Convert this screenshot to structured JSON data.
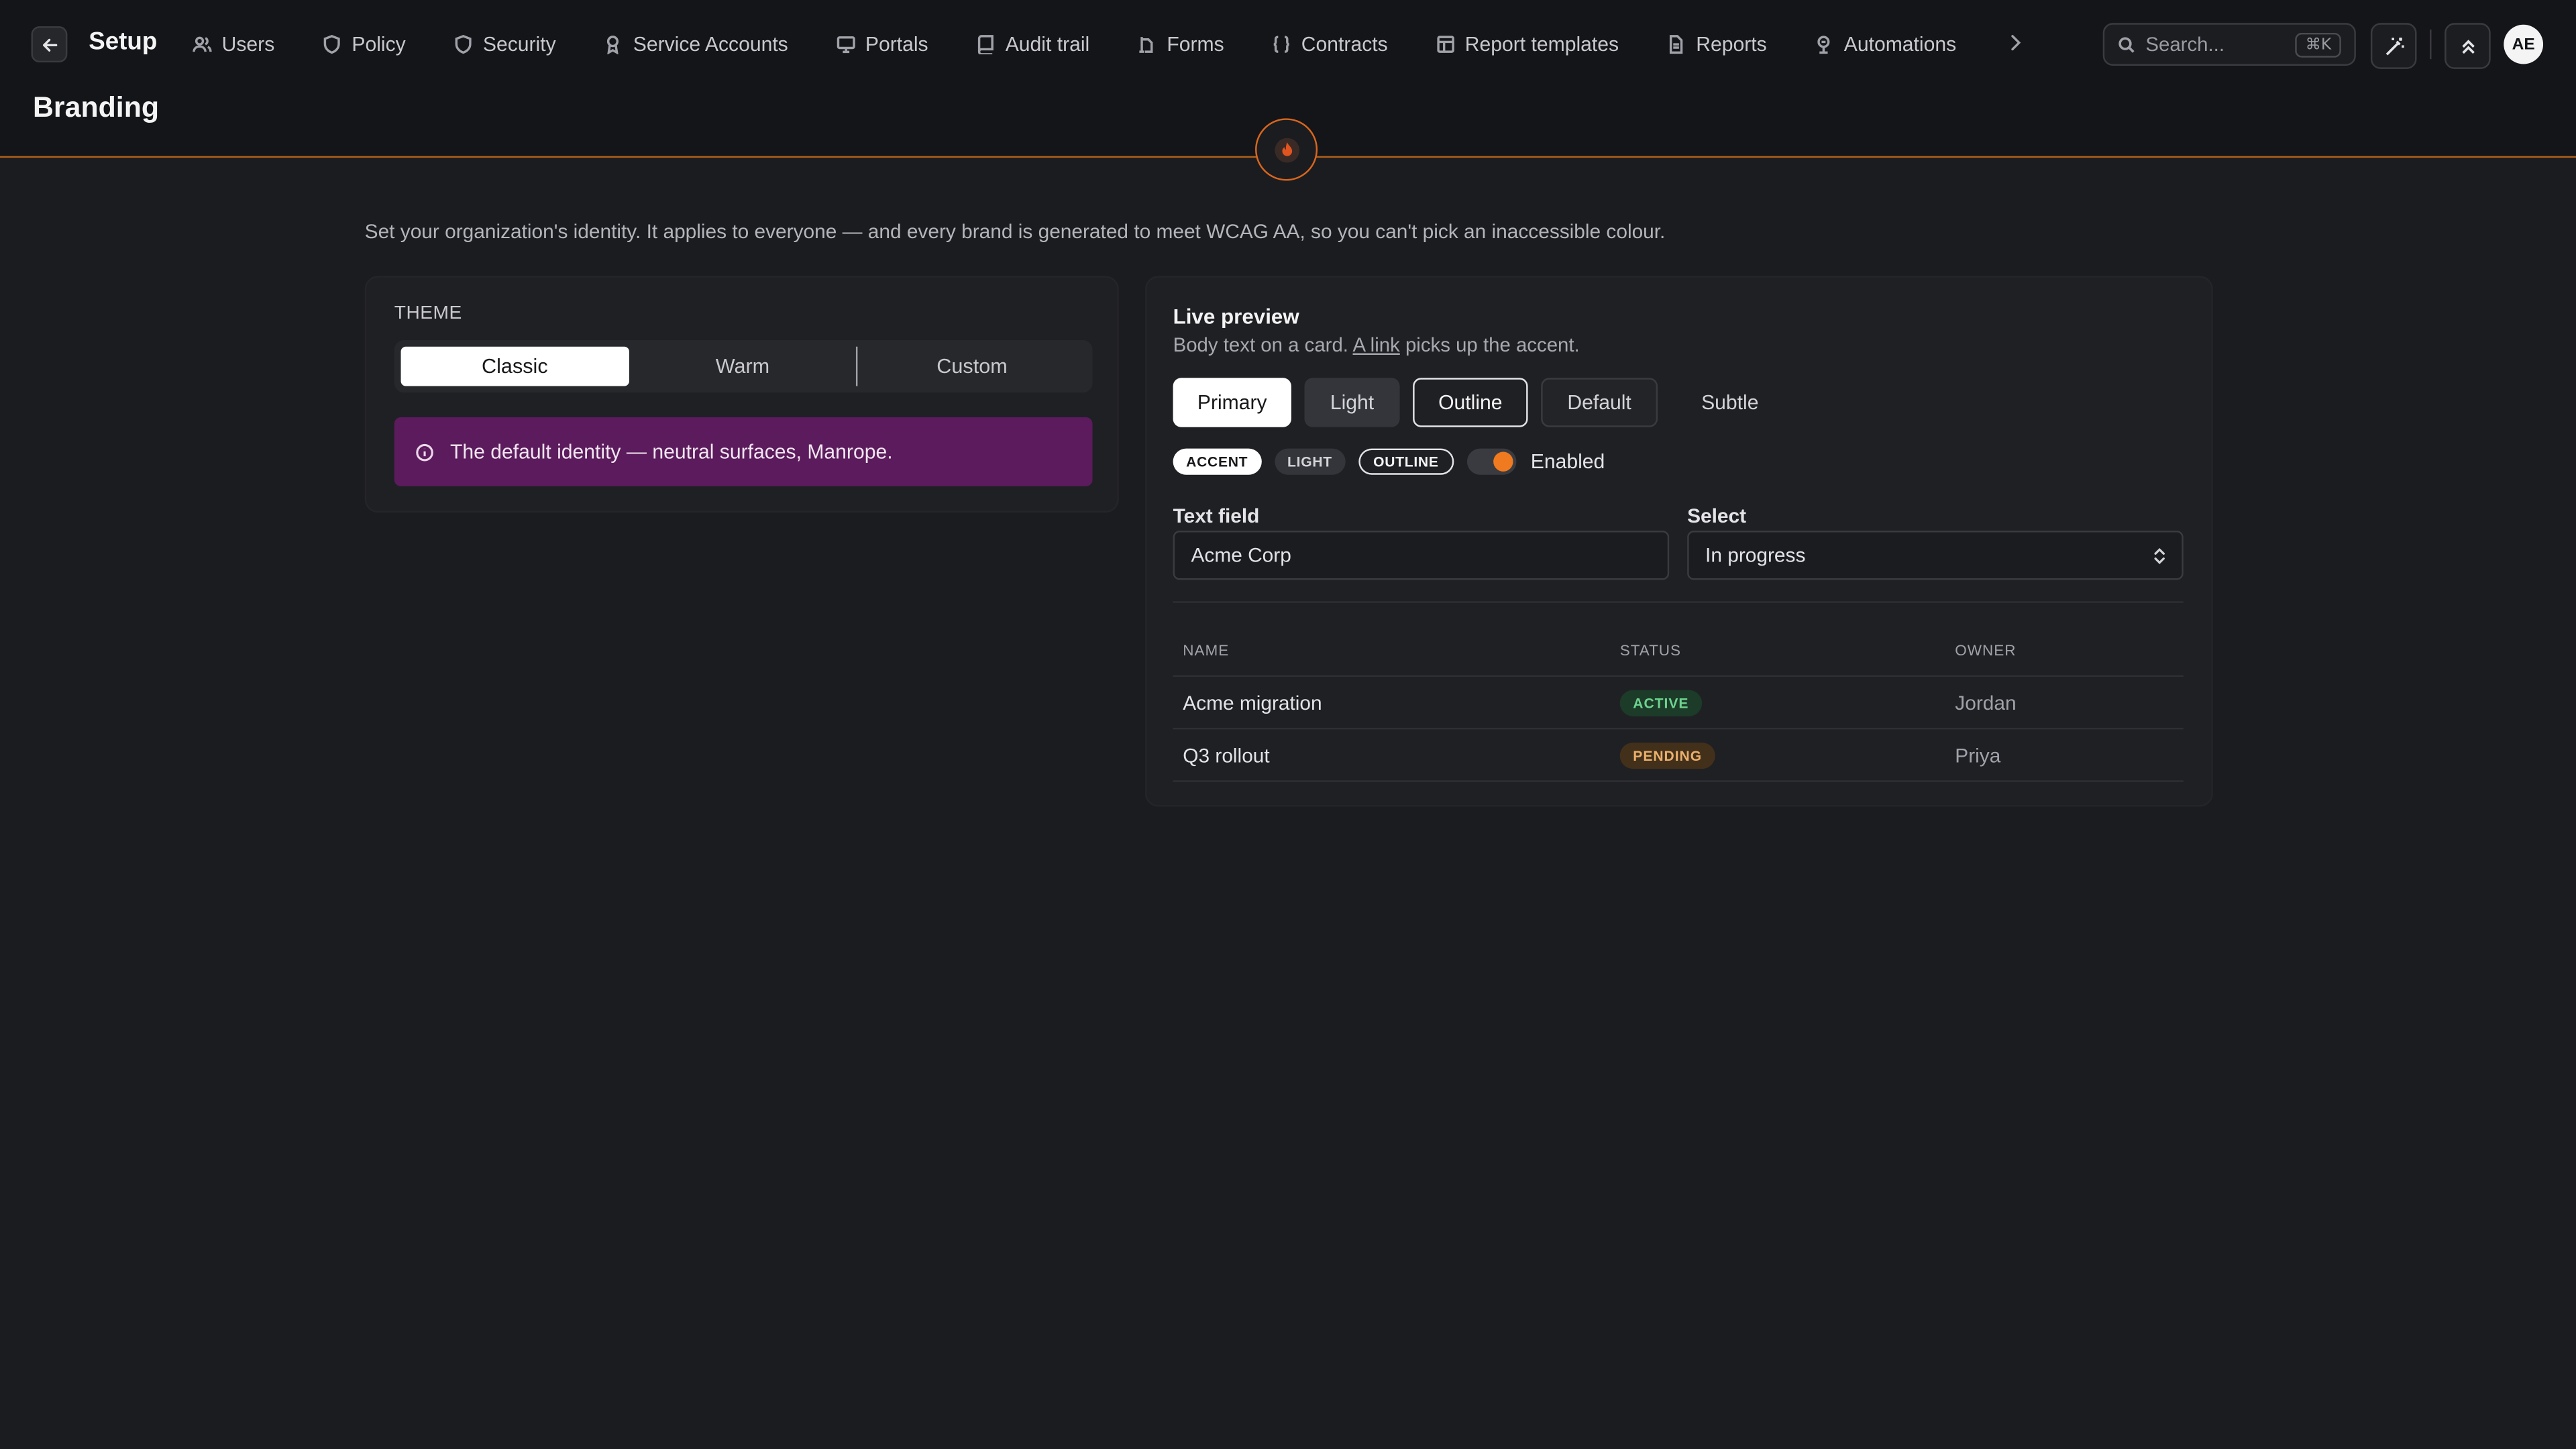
{
  "header": {
    "title": "Setup",
    "nav": [
      {
        "label": "Users",
        "icon": "users-icon"
      },
      {
        "label": "Policy",
        "icon": "shield-icon"
      },
      {
        "label": "Security",
        "icon": "shield-check-icon"
      },
      {
        "label": "Service Accounts",
        "icon": "badge-icon"
      },
      {
        "label": "Portals",
        "icon": "monitor-icon"
      },
      {
        "label": "Audit trail",
        "icon": "book-icon"
      },
      {
        "label": "Forms",
        "icon": "forms-icon"
      },
      {
        "label": "Contracts",
        "icon": "braces-icon"
      },
      {
        "label": "Report templates",
        "icon": "template-icon"
      },
      {
        "label": "Reports",
        "icon": "file-icon"
      },
      {
        "label": "Automations",
        "icon": "automation-icon"
      }
    ],
    "search": {
      "placeholder": "Search...",
      "shortcut": "⌘K"
    },
    "avatar_initials": "AE"
  },
  "page": {
    "title": "Branding",
    "intro": "Set your organization's identity. It applies to everyone — and every brand is generated to meet WCAG AA, so you can't pick an inaccessible colour."
  },
  "theme": {
    "label": "THEME",
    "options": [
      "Classic",
      "Warm",
      "Custom"
    ],
    "selected": "Classic",
    "info": "The default identity — neutral surfaces, Manrope."
  },
  "preview": {
    "title": "Live preview",
    "body_prefix": "Body text on a card.",
    "link_text": "A link",
    "body_suffix": "picks up the accent.",
    "buttons": {
      "primary": "Primary",
      "light": "Light",
      "outline": "Outline",
      "default": "Default",
      "subtle": "Subtle"
    },
    "badges": {
      "accent": "ACCENT",
      "light": "LIGHT",
      "outline": "OUTLINE"
    },
    "toggle": {
      "label": "Enabled",
      "on": true
    },
    "text_field": {
      "label": "Text field",
      "value": "Acme Corp"
    },
    "select": {
      "label": "Select",
      "value": "In progress"
    },
    "table": {
      "columns": [
        "NAME",
        "STATUS",
        "OWNER"
      ],
      "rows": [
        {
          "name": "Acme migration",
          "status": "ACTIVE",
          "owner": "Jordan"
        },
        {
          "name": "Q3 rollout",
          "status": "PENDING",
          "owner": "Priya"
        }
      ]
    }
  },
  "colors": {
    "accent": "#f07a1f",
    "info_bg": "#5b1b5c",
    "header_bg": "#141518",
    "page_bg": "#1b1c20",
    "status_active": "#6ed38f",
    "status_pending": "#eab06b"
  }
}
